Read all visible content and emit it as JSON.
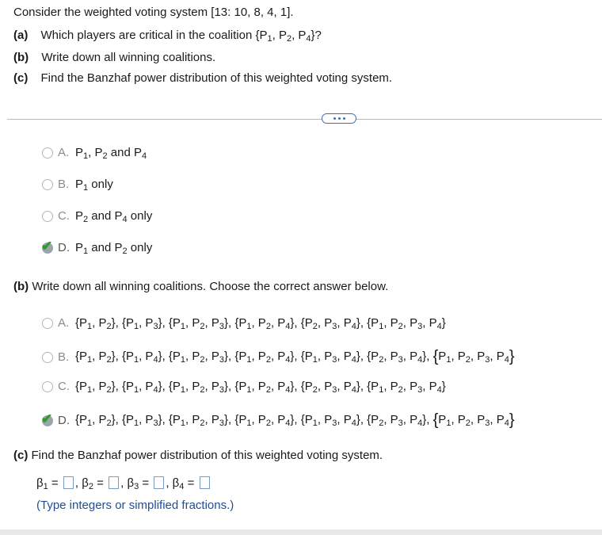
{
  "question": {
    "intro": "Consider the weighted voting system [13: 10, 8, 4, 1].",
    "parts": [
      {
        "label": "(a)",
        "text": "Which players are critical in the coalition {P1, P2, P4}?"
      },
      {
        "label": "(b)",
        "text": "Write down all winning coalitions."
      },
      {
        "label": "(c)",
        "text": "Find the Banzhaf power distribution of this weighted voting system."
      }
    ]
  },
  "more_button": {
    "label": "..."
  },
  "part_a": {
    "options": [
      {
        "letter": "A.",
        "text": "P1, P2 and P4",
        "selected": false
      },
      {
        "letter": "B.",
        "text": "P1 only",
        "selected": false
      },
      {
        "letter": "C.",
        "text": "P2 and P4 only",
        "selected": false
      },
      {
        "letter": "D.",
        "text": "P1 and P2 only",
        "selected": true
      }
    ]
  },
  "part_b": {
    "prompt_label": "(b)",
    "prompt_text": "Write down all winning coalitions. Choose the correct answer below.",
    "options": [
      {
        "letter": "A.",
        "text": "{P1, P2}, {P1, P3}, {P1, P2, P3}, {P1, P2, P4}, {P2, P3, P4}, {P1, P2, P3, P4}",
        "selected": false
      },
      {
        "letter": "B.",
        "text": "{P1, P2}, {P1, P4}, {P1, P2, P3}, {P1, P2, P4}, {P1, P3, P4}, {P2, P3, P4}, {P1, P2, P3, P4}",
        "selected": false
      },
      {
        "letter": "C.",
        "text": "{P1, P2}, {P1, P4}, {P1, P2, P3}, {P1, P2, P4}, {P2, P3, P4}, {P1, P2, P3, P4}",
        "selected": false
      },
      {
        "letter": "D.",
        "text": "{P1, P2}, {P1, P3}, {P1, P2, P3}, {P1, P2, P4}, {P1, P3, P4}, {P2, P3, P4}, {P1, P2, P3, P4}",
        "selected": true
      }
    ]
  },
  "part_c": {
    "prompt_label": "(c)",
    "prompt_text": "Find the Banzhaf power distribution of this weighted voting system.",
    "answers": [
      {
        "symbol": "β1",
        "value": ""
      },
      {
        "symbol": "β2",
        "value": ""
      },
      {
        "symbol": "β3",
        "value": ""
      },
      {
        "symbol": "β4",
        "value": ""
      }
    ],
    "note": "(Type integers or simplified fractions.)"
  },
  "colors": {
    "check": "#2e9a2e",
    "note": "#1f4e96",
    "box_border": "#7a9cc6"
  },
  "icons": {
    "selected_mark": "check-icon",
    "more": "ellipsis-icon"
  }
}
